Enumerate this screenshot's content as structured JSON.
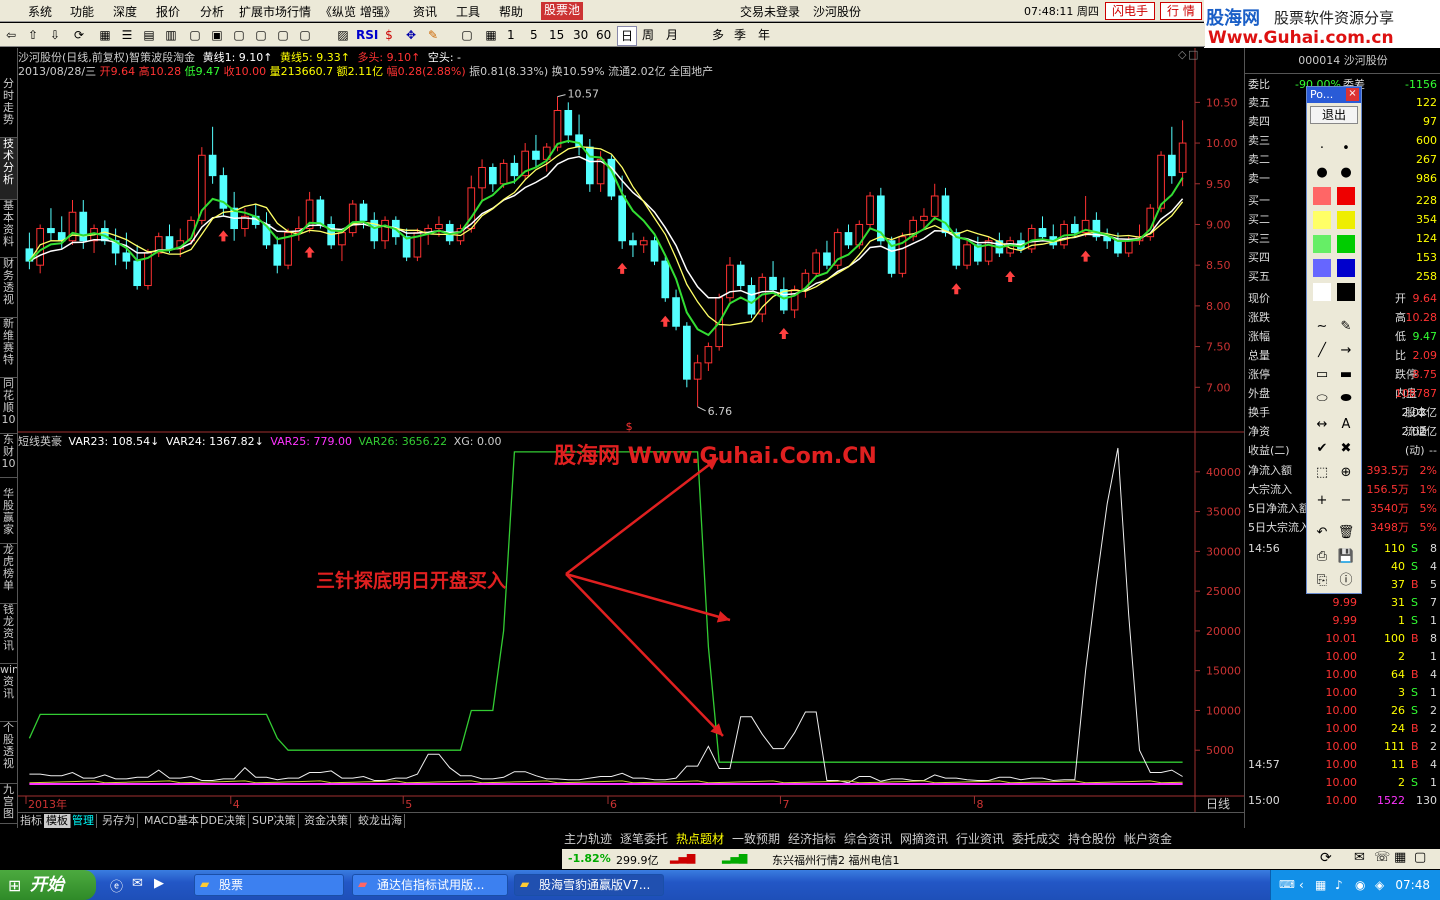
{
  "menu": {
    "items": [
      "系统",
      "功能",
      "深度",
      "报价",
      "分析",
      "扩展市场行情",
      "《纵览 增强》",
      "资讯",
      "工具",
      "帮助"
    ],
    "active": "股票池",
    "login": "交易未登录",
    "stock": "沙河股份",
    "time": "07:48:11 周四",
    "flash_btn": "闪电手",
    "quote_btn": "行 情"
  },
  "logo": {
    "l1": "股海网",
    "l2": "股票软件资源分享",
    "l3": "Www.Guhai.com.cn"
  },
  "toolbar": {
    "periods": [
      "1",
      "5",
      "15",
      "30",
      "60",
      "日",
      "周",
      "月",
      "多",
      "季",
      "年"
    ],
    "rsi": "RSI"
  },
  "left_tabs": [
    "分时走势",
    "技术分析",
    "基本资料",
    "财务透视",
    "新维赛特",
    "同花顺10",
    "东财10",
    "华股赢家",
    "龙虎榜单",
    "钱龙资讯",
    "wind资讯",
    "个股透视",
    "九宫图"
  ],
  "header": {
    "line1_title": "沙河股份(日线,前复权)智策波段淘金",
    "huangxian1": "黄线1: 9.10↑",
    "huangxian5": "黄线5: 9.33↑",
    "duotou": "多头: 9.10↑",
    "kongtou": "空头: -",
    "line2_date": "2013/08/28/三",
    "open": "开9.64",
    "high": "高10.28",
    "low": "低9.47",
    "close": "收10.00",
    "volume": "量213660.7",
    "amount": "额2.11亿",
    "range": "幅0.28(2.88%)",
    "amp": "振0.81(8.33%)",
    "turnover": "换10.59%",
    "float": "流通2.02亿",
    "sector": "全国地产"
  },
  "indicator": {
    "name": "短线英豪",
    "var23": "VAR23: 108.54↓",
    "var24": "VAR24: 1367.82↓",
    "var25": "VAR25: 779.00",
    "var26": "VAR26: 3656.22",
    "xg": "XG: 0.00"
  },
  "annotations": {
    "watermark": "股海网 Www.Guhai.Com.CN",
    "note": "三针探底明日开盘买入",
    "max_label": "10.57",
    "min_label": "6.76"
  },
  "price_axis": [
    "10.50",
    "10.00",
    "9.50",
    "9.00",
    "8.50",
    "8.00",
    "7.50",
    "7.00"
  ],
  "ind_axis": [
    "40000",
    "35000",
    "30000",
    "25000",
    "20000",
    "15000",
    "10000",
    "5000"
  ],
  "time_axis": [
    "2013年",
    "4",
    "5",
    "6",
    "7",
    "8"
  ],
  "period_label": "日线",
  "bottom_tabs": [
    "指标",
    "模板",
    "管理",
    "另存为",
    "MACD基本",
    "DDE决策",
    "SUP决策",
    "资金决策",
    "蛟龙出海"
  ],
  "right": {
    "code": "000014 沙河股份",
    "weibi": "委比",
    "weibi_v": "-90.00%",
    "weicha": "委差",
    "weicha_v": "-1156",
    "sell": [
      {
        "l": "卖五",
        "v": "122"
      },
      {
        "l": "卖四",
        "v": "97"
      },
      {
        "l": "卖三",
        "v": "600"
      },
      {
        "l": "卖二",
        "v": "267"
      },
      {
        "l": "卖一",
        "v": "986"
      }
    ],
    "buy": [
      {
        "l": "买一",
        "v": "228"
      },
      {
        "l": "买二",
        "v": "354"
      },
      {
        "l": "买三",
        "v": "124"
      },
      {
        "l": "买四",
        "v": "153"
      },
      {
        "l": "买五",
        "v": "258"
      }
    ],
    "info": [
      {
        "l": "现价",
        "r": "开",
        "v": "9.64"
      },
      {
        "l": "涨跌",
        "r": "高",
        "v": "10.28"
      },
      {
        "l": "涨幅",
        "r": "低",
        "v": "9.47"
      },
      {
        "l": "总量",
        "r": "比",
        "v": "2.09"
      },
      {
        "l": "涨停",
        "r": "跌停",
        "v": "8.75"
      },
      {
        "l": "外盘",
        "r": "内盘",
        "v": "108787"
      }
    ],
    "info2": [
      {
        "l": "换手",
        "r": "股本",
        "v": "2.02亿"
      },
      {
        "l": "净资",
        "r": "流通",
        "v": "2.02亿"
      },
      {
        "l": "收益(二)",
        "r": "(动)",
        "v": "--"
      }
    ],
    "flow": [
      {
        "l": "净流入额",
        "v": "393.5万",
        "p": "2%"
      },
      {
        "l": "大宗流入",
        "v": "156.5万",
        "p": "1%"
      },
      {
        "l": "5日净流入额",
        "v": "3540万",
        "p": "5%"
      },
      {
        "l": "5日大宗流入",
        "v": "3498万",
        "p": "5%"
      }
    ],
    "ticks": [
      {
        "t": "14:56",
        "p": "",
        "v": "110",
        "s": "S",
        "n": "8"
      },
      {
        "t": "",
        "p": "",
        "v": "40",
        "s": "S",
        "n": "4"
      },
      {
        "t": "",
        "p": "",
        "v": "37",
        "s": "B",
        "n": "5"
      },
      {
        "t": "",
        "p": "9.99",
        "v": "31",
        "s": "S",
        "n": "7"
      },
      {
        "t": "",
        "p": "9.99",
        "v": "1",
        "s": "S",
        "n": "1"
      },
      {
        "t": "",
        "p": "10.01",
        "v": "100",
        "s": "B",
        "n": "8"
      },
      {
        "t": "",
        "p": "10.00",
        "v": "2",
        "s": "",
        "n": "1"
      },
      {
        "t": "",
        "p": "10.00",
        "v": "64",
        "s": "B",
        "n": "4"
      },
      {
        "t": "",
        "p": "10.00",
        "v": "3",
        "s": "S",
        "n": "1"
      },
      {
        "t": "",
        "p": "10.00",
        "v": "26",
        "s": "S",
        "n": "2"
      },
      {
        "t": "",
        "p": "10.00",
        "v": "24",
        "s": "B",
        "n": "2"
      },
      {
        "t": "",
        "p": "10.00",
        "v": "111",
        "s": "B",
        "n": "2"
      },
      {
        "t": "14:57",
        "p": "10.00",
        "v": "11",
        "s": "B",
        "n": "4"
      },
      {
        "t": "",
        "p": "10.00",
        "v": "2",
        "s": "S",
        "n": "1"
      },
      {
        "t": "15:00",
        "p": "10.00",
        "v": "1522",
        "s": "",
        "n": "130"
      }
    ],
    "bottom_tabs": [
      "图文F10",
      "笔",
      "价",
      "细",
      "盘",
      "势",
      "指",
      "值",
      "筹"
    ]
  },
  "palette": {
    "title": "Po...",
    "exit": "退出"
  },
  "funcbar": [
    "主力轨迹",
    "逐笔委托",
    "热点题材",
    "一致预期",
    "经济指标",
    "综合资讯",
    "网摘资讯",
    "行业资讯",
    "委托成交",
    "持仓股份",
    "帐户资金"
  ],
  "status": {
    "pct": "-1.82%",
    "amt": "299.9亿",
    "ticker": "东兴福州行情2 福州电信1"
  },
  "taskbar": {
    "start": "开始",
    "tasks": [
      "股票",
      "通达信指标试用版...",
      "股海雪豹通赢版V7..."
    ],
    "clock": "07:48"
  },
  "colors": {
    "up": "#ff3232",
    "down": "#54ffff",
    "ma_white": "#ffffff",
    "ma_yellow": "#ffff66",
    "ma_green": "#33dd33",
    "ind_green": "#33cc33",
    "ind_white": "#eeeeee",
    "ind_magenta": "#ff33ff",
    "annotation": "#e02020"
  },
  "chart_data": {
    "type": "candlestick",
    "title": "沙河股份(日线,前复权)",
    "price_range": [
      6.5,
      10.75
    ],
    "candles": [
      {
        "o": 8.7,
        "h": 8.9,
        "l": 8.45,
        "c": 8.55
      },
      {
        "o": 8.5,
        "h": 9.0,
        "l": 8.4,
        "c": 8.95
      },
      {
        "o": 8.95,
        "h": 9.2,
        "l": 8.8,
        "c": 8.9
      },
      {
        "o": 8.9,
        "h": 9.1,
        "l": 8.7,
        "c": 8.8
      },
      {
        "o": 8.8,
        "h": 9.3,
        "l": 8.75,
        "c": 9.15
      },
      {
        "o": 9.15,
        "h": 9.3,
        "l": 8.7,
        "c": 8.8
      },
      {
        "o": 8.8,
        "h": 9.0,
        "l": 8.65,
        "c": 8.95
      },
      {
        "o": 8.95,
        "h": 9.05,
        "l": 8.75,
        "c": 8.8
      },
      {
        "o": 8.8,
        "h": 8.95,
        "l": 8.5,
        "c": 8.65
      },
      {
        "o": 8.65,
        "h": 8.9,
        "l": 8.45,
        "c": 8.55
      },
      {
        "o": 8.55,
        "h": 8.75,
        "l": 8.2,
        "c": 8.25
      },
      {
        "o": 8.25,
        "h": 8.7,
        "l": 8.2,
        "c": 8.65
      },
      {
        "o": 8.65,
        "h": 8.9,
        "l": 8.6,
        "c": 8.85
      },
      {
        "o": 8.85,
        "h": 9.0,
        "l": 8.65,
        "c": 8.7
      },
      {
        "o": 8.7,
        "h": 8.95,
        "l": 8.6,
        "c": 8.8
      },
      {
        "o": 8.8,
        "h": 9.1,
        "l": 8.75,
        "c": 9.05
      },
      {
        "o": 9.05,
        "h": 9.95,
        "l": 9.0,
        "c": 9.85
      },
      {
        "o": 9.85,
        "h": 10.2,
        "l": 9.5,
        "c": 9.6
      },
      {
        "o": 9.6,
        "h": 9.7,
        "l": 9.1,
        "c": 9.2
      },
      {
        "o": 9.2,
        "h": 9.4,
        "l": 8.8,
        "c": 8.95
      },
      {
        "o": 8.95,
        "h": 9.2,
        "l": 8.85,
        "c": 9.1
      },
      {
        "o": 9.1,
        "h": 9.25,
        "l": 8.95,
        "c": 9.0
      },
      {
        "o": 9.0,
        "h": 9.15,
        "l": 8.7,
        "c": 8.75
      },
      {
        "o": 8.75,
        "h": 8.85,
        "l": 8.4,
        "c": 8.5
      },
      {
        "o": 8.5,
        "h": 8.95,
        "l": 8.45,
        "c": 8.9
      },
      {
        "o": 8.9,
        "h": 9.1,
        "l": 8.8,
        "c": 8.95
      },
      {
        "o": 8.95,
        "h": 9.4,
        "l": 8.9,
        "c": 9.3
      },
      {
        "o": 9.3,
        "h": 9.35,
        "l": 8.95,
        "c": 9.0
      },
      {
        "o": 9.0,
        "h": 9.1,
        "l": 8.7,
        "c": 8.75
      },
      {
        "o": 8.75,
        "h": 8.95,
        "l": 8.55,
        "c": 8.9
      },
      {
        "o": 8.9,
        "h": 9.3,
        "l": 8.85,
        "c": 9.25
      },
      {
        "o": 9.25,
        "h": 9.3,
        "l": 8.95,
        "c": 9.05
      },
      {
        "o": 9.05,
        "h": 9.15,
        "l": 8.7,
        "c": 8.8
      },
      {
        "o": 8.8,
        "h": 9.1,
        "l": 8.7,
        "c": 9.05
      },
      {
        "o": 9.05,
        "h": 9.1,
        "l": 8.75,
        "c": 8.85
      },
      {
        "o": 8.85,
        "h": 8.95,
        "l": 8.55,
        "c": 8.6
      },
      {
        "o": 8.6,
        "h": 8.95,
        "l": 8.55,
        "c": 8.9
      },
      {
        "o": 8.9,
        "h": 9.0,
        "l": 8.75,
        "c": 8.95
      },
      {
        "o": 8.95,
        "h": 9.1,
        "l": 8.85,
        "c": 9.0
      },
      {
        "o": 9.0,
        "h": 9.05,
        "l": 8.75,
        "c": 8.8
      },
      {
        "o": 8.8,
        "h": 9.0,
        "l": 8.75,
        "c": 8.95
      },
      {
        "o": 8.95,
        "h": 9.6,
        "l": 8.9,
        "c": 9.45
      },
      {
        "o": 9.45,
        "h": 9.8,
        "l": 9.3,
        "c": 9.7
      },
      {
        "o": 9.7,
        "h": 9.75,
        "l": 9.4,
        "c": 9.5
      },
      {
        "o": 9.5,
        "h": 9.8,
        "l": 9.45,
        "c": 9.75
      },
      {
        "o": 9.75,
        "h": 9.85,
        "l": 9.5,
        "c": 9.6
      },
      {
        "o": 9.6,
        "h": 10.0,
        "l": 9.55,
        "c": 9.9
      },
      {
        "o": 9.9,
        "h": 10.1,
        "l": 9.7,
        "c": 9.8
      },
      {
        "o": 9.8,
        "h": 10.0,
        "l": 9.65,
        "c": 9.95
      },
      {
        "o": 9.95,
        "h": 10.57,
        "l": 9.9,
        "c": 10.4
      },
      {
        "o": 10.4,
        "h": 10.5,
        "l": 10.0,
        "c": 10.1
      },
      {
        "o": 10.1,
        "h": 10.35,
        "l": 9.85,
        "c": 9.95
      },
      {
        "o": 9.95,
        "h": 10.05,
        "l": 9.4,
        "c": 9.5
      },
      {
        "o": 9.5,
        "h": 9.9,
        "l": 9.4,
        "c": 9.8
      },
      {
        "o": 9.8,
        "h": 9.85,
        "l": 9.3,
        "c": 9.35
      },
      {
        "o": 9.35,
        "h": 9.6,
        "l": 8.7,
        "c": 8.8
      },
      {
        "o": 8.8,
        "h": 8.9,
        "l": 8.6,
        "c": 8.75
      },
      {
        "o": 8.75,
        "h": 8.85,
        "l": 8.65,
        "c": 8.8
      },
      {
        "o": 8.8,
        "h": 8.85,
        "l": 8.5,
        "c": 8.55
      },
      {
        "o": 8.55,
        "h": 8.6,
        "l": 8.05,
        "c": 8.1
      },
      {
        "o": 8.1,
        "h": 8.2,
        "l": 7.7,
        "c": 7.75
      },
      {
        "o": 7.75,
        "h": 7.8,
        "l": 7.0,
        "c": 7.1
      },
      {
        "o": 7.1,
        "h": 7.4,
        "l": 6.76,
        "c": 7.3
      },
      {
        "o": 7.3,
        "h": 7.55,
        "l": 7.2,
        "c": 7.5
      },
      {
        "o": 7.5,
        "h": 8.15,
        "l": 7.45,
        "c": 8.1
      },
      {
        "o": 8.1,
        "h": 8.6,
        "l": 8.05,
        "c": 8.5
      },
      {
        "o": 8.5,
        "h": 8.55,
        "l": 8.2,
        "c": 8.25
      },
      {
        "o": 8.25,
        "h": 8.35,
        "l": 7.85,
        "c": 7.9
      },
      {
        "o": 7.9,
        "h": 8.4,
        "l": 7.8,
        "c": 8.35
      },
      {
        "o": 8.35,
        "h": 8.55,
        "l": 8.15,
        "c": 8.2
      },
      {
        "o": 8.2,
        "h": 8.35,
        "l": 7.9,
        "c": 7.95
      },
      {
        "o": 7.95,
        "h": 8.25,
        "l": 7.85,
        "c": 8.2
      },
      {
        "o": 8.2,
        "h": 8.45,
        "l": 8.1,
        "c": 8.4
      },
      {
        "o": 8.4,
        "h": 8.7,
        "l": 8.35,
        "c": 8.65
      },
      {
        "o": 8.65,
        "h": 8.8,
        "l": 8.45,
        "c": 8.5
      },
      {
        "o": 8.5,
        "h": 8.95,
        "l": 8.45,
        "c": 8.9
      },
      {
        "o": 8.9,
        "h": 9.0,
        "l": 8.7,
        "c": 8.75
      },
      {
        "o": 8.75,
        "h": 9.05,
        "l": 8.7,
        "c": 9.0
      },
      {
        "o": 9.0,
        "h": 9.4,
        "l": 8.95,
        "c": 9.35
      },
      {
        "o": 9.35,
        "h": 9.45,
        "l": 8.75,
        "c": 8.8
      },
      {
        "o": 8.8,
        "h": 8.85,
        "l": 8.35,
        "c": 8.4
      },
      {
        "o": 8.4,
        "h": 8.9,
        "l": 8.35,
        "c": 8.85
      },
      {
        "o": 8.85,
        "h": 9.1,
        "l": 8.8,
        "c": 9.05
      },
      {
        "o": 9.05,
        "h": 9.2,
        "l": 8.95,
        "c": 9.1
      },
      {
        "o": 9.1,
        "h": 9.5,
        "l": 9.05,
        "c": 9.35
      },
      {
        "o": 9.35,
        "h": 9.45,
        "l": 8.85,
        "c": 8.9
      },
      {
        "o": 8.9,
        "h": 8.95,
        "l": 8.45,
        "c": 8.5
      },
      {
        "o": 8.5,
        "h": 8.8,
        "l": 8.45,
        "c": 8.75
      },
      {
        "o": 8.75,
        "h": 8.85,
        "l": 8.5,
        "c": 8.55
      },
      {
        "o": 8.55,
        "h": 8.85,
        "l": 8.5,
        "c": 8.8
      },
      {
        "o": 8.8,
        "h": 8.9,
        "l": 8.6,
        "c": 8.65
      },
      {
        "o": 8.65,
        "h": 8.85,
        "l": 8.6,
        "c": 8.8
      },
      {
        "o": 8.8,
        "h": 8.9,
        "l": 8.65,
        "c": 8.7
      },
      {
        "o": 8.7,
        "h": 9.0,
        "l": 8.65,
        "c": 8.95
      },
      {
        "o": 8.95,
        "h": 9.1,
        "l": 8.8,
        "c": 8.85
      },
      {
        "o": 8.85,
        "h": 9.0,
        "l": 8.7,
        "c": 8.75
      },
      {
        "o": 8.75,
        "h": 9.05,
        "l": 8.7,
        "c": 9.0
      },
      {
        "o": 9.0,
        "h": 9.1,
        "l": 8.85,
        "c": 8.9
      },
      {
        "o": 8.9,
        "h": 9.35,
        "l": 8.85,
        "c": 9.05
      },
      {
        "o": 9.05,
        "h": 9.15,
        "l": 8.8,
        "c": 8.85
      },
      {
        "o": 8.85,
        "h": 8.95,
        "l": 8.7,
        "c": 8.8
      },
      {
        "o": 8.8,
        "h": 8.9,
        "l": 8.6,
        "c": 8.65
      },
      {
        "o": 8.65,
        "h": 8.85,
        "l": 8.6,
        "c": 8.8
      },
      {
        "o": 8.8,
        "h": 9.0,
        "l": 8.75,
        "c": 8.85
      },
      {
        "o": 8.85,
        "h": 9.25,
        "l": 8.8,
        "c": 9.2
      },
      {
        "o": 9.2,
        "h": 9.9,
        "l": 9.15,
        "c": 9.85
      },
      {
        "o": 9.85,
        "h": 10.2,
        "l": 9.5,
        "c": 9.6
      },
      {
        "o": 9.64,
        "h": 10.28,
        "l": 9.47,
        "c": 10.0
      }
    ],
    "buy_arrows": [
      18,
      26,
      55,
      59,
      70,
      86,
      91,
      98
    ],
    "ind_range": [
      0,
      44000
    ],
    "ind_green": [
      {
        "i": 0,
        "v": 6500
      },
      {
        "i": 1,
        "v": 9500
      },
      {
        "i": 22,
        "v": 9500
      },
      {
        "i": 23,
        "v": 6500
      },
      {
        "i": 24,
        "v": 5000
      },
      {
        "i": 40,
        "v": 5000
      },
      {
        "i": 41,
        "v": 10000
      },
      {
        "i": 43,
        "v": 10000
      },
      {
        "i": 44,
        "v": 20000
      },
      {
        "i": 45,
        "v": 42500
      },
      {
        "i": 62,
        "v": 42500
      },
      {
        "i": 63,
        "v": 18000
      },
      {
        "i": 64,
        "v": 3500
      },
      {
        "i": 67,
        "v": 3500
      }
    ],
    "ind_white": [
      2000,
      1800,
      2200,
      1500,
      1900,
      1400,
      1600,
      2500,
      1500,
      1700,
      1200,
      1400,
      2800,
      1600,
      1300,
      1500,
      2200,
      2400,
      1500,
      1700,
      1200,
      1500,
      2000,
      4500,
      2800,
      1800,
      1400,
      1600,
      2300,
      1800,
      1400,
      1300,
      1500,
      1700,
      2100,
      1500,
      1300,
      1500,
      3000,
      5500,
      2700,
      9200,
      7000,
      5200,
      7200,
      9800,
      1200,
      900,
      1700,
      1100,
      1400,
      1200,
      1900,
      1500,
      1300,
      1200,
      1600,
      1300,
      1500,
      1200,
      1300,
      1500,
      1800,
      1400,
      1700,
      2200,
      2500,
      1700
    ]
  }
}
